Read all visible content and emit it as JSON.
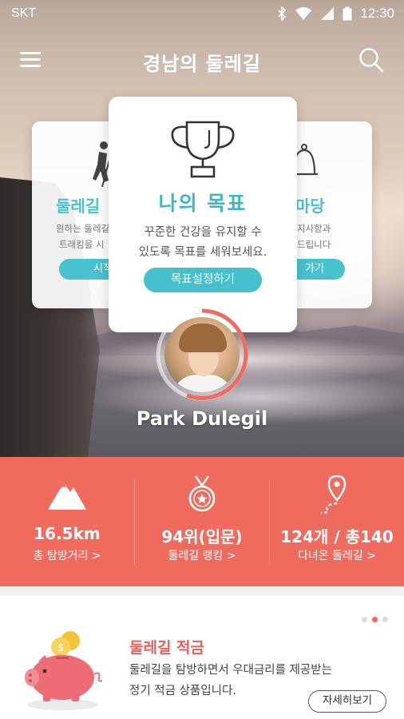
{
  "status_bar": {
    "carrier": "SKT",
    "time": "12:30"
  },
  "header": {
    "title": "경남의 둘레길"
  },
  "cards": {
    "left": {
      "title": "둘레길",
      "desc_line1": "원하는 둘레길",
      "desc_line2": "트래킹을 시",
      "button": "시작"
    },
    "center": {
      "title": "나의 목표",
      "desc_line1": "꾸준한 건강을 유지할 수",
      "desc_line2": "있도록 목표를 세워보세요.",
      "button": "목표설정하기"
    },
    "right": {
      "title": "마당",
      "desc_line1": "지사항과",
      "desc_line2": "드립니다",
      "button": "가기"
    }
  },
  "profile": {
    "name": "Park Dulegil"
  },
  "stats": [
    {
      "value": "16.5km",
      "label": "총 탐방거리 >",
      "icon": "mountain-icon"
    },
    {
      "value": "94위(입문)",
      "label": "둘레길 랭킹 >",
      "icon": "medal-icon"
    },
    {
      "value": "124개 / 총140",
      "label": "다녀온 둘레길 >",
      "icon": "map-pin-path-icon"
    }
  ],
  "promo": {
    "title": "둘레길 적금",
    "desc_line1": "둘레길을 탐방하면서 우대금리를 제공받는",
    "desc_line2": "정기 적금 상품입니다.",
    "button": "자세히보기",
    "page_count": 3,
    "active_page": 2
  },
  "colors": {
    "accent_teal": "#46c0cd",
    "accent_coral": "#ee6b5e",
    "promo_title": "#e8605a"
  }
}
